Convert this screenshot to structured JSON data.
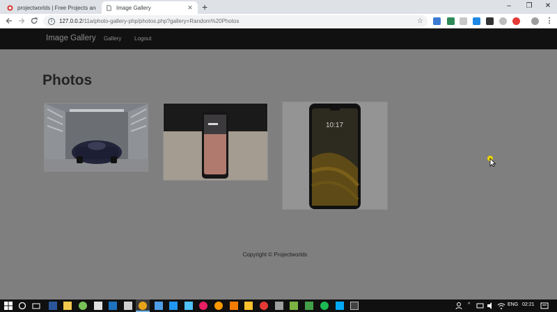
{
  "browser": {
    "tabs": [
      {
        "title": "projectworlds | Free Projects and",
        "active": false
      },
      {
        "title": "Image Gallery",
        "active": true
      }
    ],
    "new_tab_symbol": "+",
    "url_host": "127.0.0.2",
    "url_path": "/11a/photo-gallery-php/photos.php?gallery=Random%20Photos",
    "window_controls": [
      "–",
      "❐",
      "✕"
    ]
  },
  "site": {
    "brand": "Image Gallery",
    "nav": [
      "Gallery",
      "Logout"
    ],
    "page_title": "Photos",
    "photos": [
      {
        "subject": "car-in-garage"
      },
      {
        "subject": "phone-on-table"
      },
      {
        "subject": "phone-front"
      }
    ],
    "footer": "Copyright © Projectworlds"
  },
  "taskbar": {
    "language": "ENG",
    "time": "02:21"
  },
  "colors": {
    "overlay": "#7f7f7f",
    "navbar": "#111111",
    "tabstrip": "#dee1e6",
    "taskbar": "#101010"
  }
}
